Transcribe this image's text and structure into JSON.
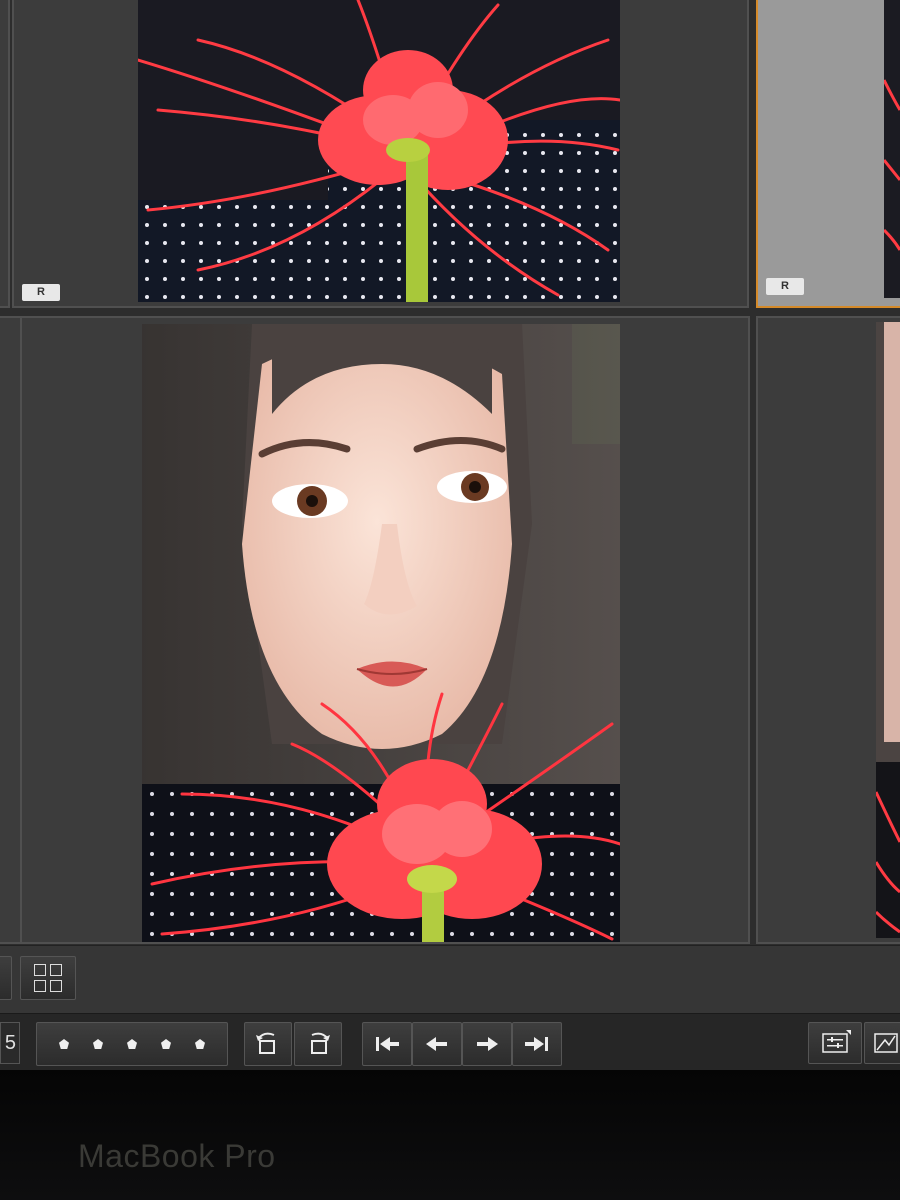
{
  "grid": {
    "cells": [
      {
        "name": "thumb-row1-col1",
        "badge": "R",
        "selected": false
      },
      {
        "name": "thumb-row1-col2",
        "badge": "R",
        "selected": true
      },
      {
        "name": "thumb-row2-col1",
        "selected": false
      }
    ]
  },
  "toolbar": {
    "filmstrip_number": "5",
    "rating_stars": 5,
    "icons": {
      "grid_view": "grid-view-icon",
      "rotate_left": "rotate-left-icon",
      "rotate_right": "rotate-right-icon",
      "first": "first-photo-icon",
      "previous": "previous-photo-icon",
      "next": "next-photo-icon",
      "last": "last-photo-icon",
      "toolbar_options": "toolbar-options-icon"
    }
  },
  "device": {
    "brand": "MacBook Pro"
  },
  "colors": {
    "selection": "#d48a2a",
    "flower": "#e8303a"
  }
}
